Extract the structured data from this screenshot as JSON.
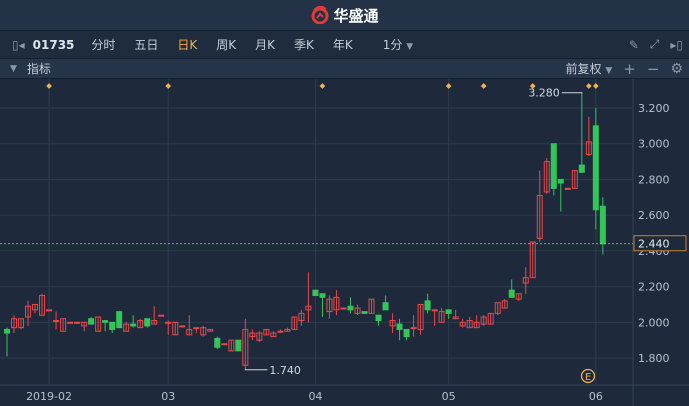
{
  "header": {
    "brand": "华盛通"
  },
  "toolbar": {
    "code": "01735",
    "tabs": [
      "分时",
      "五日",
      "日K",
      "周K",
      "月K",
      "季K",
      "年K"
    ],
    "active": "日K",
    "interval": "1分"
  },
  "indicator_bar": {
    "label": "指标",
    "adjust": "前复权"
  },
  "colors": {
    "up": "#e8484a",
    "down": "#32c55a",
    "accent": "#f0b24a",
    "grid": "#2d3b4f"
  },
  "chart_data": {
    "type": "candlestick",
    "y_ticks": [
      "3.200",
      "3.000",
      "2.800",
      "2.600",
      "2.400",
      "2.200",
      "2.000",
      "1.800"
    ],
    "ylim": [
      1.8,
      3.2
    ],
    "x_labels": [
      {
        "label": "2019-02",
        "index": 6
      },
      {
        "label": "03",
        "index": 23
      },
      {
        "label": "04",
        "index": 44
      },
      {
        "label": "05",
        "index": 63
      },
      {
        "label": "06",
        "index": 84
      }
    ],
    "current_price": "2.440",
    "max_label": "3.280",
    "min_label": "1.740",
    "candles": [
      [
        1.96,
        1.97,
        1.81,
        1.94
      ],
      [
        1.97,
        2.04,
        1.94,
        2.02
      ],
      [
        1.97,
        2.02,
        1.96,
        2.02
      ],
      [
        2.03,
        2.12,
        1.98,
        2.09
      ],
      [
        2.07,
        2.1,
        2.05,
        2.1
      ],
      [
        2.04,
        2.16,
        2.04,
        2.15
      ],
      [
        2.07,
        2.07,
        2.07,
        2.07
      ],
      [
        2.01,
        2.06,
        1.96,
        2.01
      ],
      [
        1.95,
        2.02,
        1.95,
        2.02
      ],
      [
        2,
        2,
        2,
        2
      ],
      [
        2,
        2,
        2,
        2
      ],
      [
        1.98,
        2,
        1.95,
        2
      ],
      [
        2.02,
        2.03,
        2,
        1.99
      ],
      [
        1.95,
        2.03,
        1.95,
        2.03
      ],
      [
        2.01,
        2.01,
        1.95,
        2
      ],
      [
        2,
        2,
        1.94,
        1.96
      ],
      [
        2.06,
        2.06,
        1.97,
        1.97
      ],
      [
        1.95,
        2,
        1.95,
        1.99
      ],
      [
        1.99,
        2.04,
        1.97,
        1.98
      ],
      [
        1.97,
        2.02,
        1.97,
        2.01
      ],
      [
        2.02,
        2.02,
        1.97,
        1.98
      ],
      [
        1.99,
        2.09,
        1.99,
        2.01
      ],
      [
        2.04,
        2.04,
        2.04,
        2.04
      ],
      [
        2,
        2.01,
        1.93,
        2
      ],
      [
        1.93,
        2,
        1.93,
        2
      ],
      [
        1.98,
        1.98,
        1.98,
        1.98
      ],
      [
        1.93,
        2.04,
        1.93,
        1.96
      ],
      [
        1.97,
        1.97,
        1.94,
        1.97
      ],
      [
        1.93,
        1.98,
        1.92,
        1.97
      ],
      [
        1.95,
        1.96,
        1.95,
        1.96
      ],
      [
        1.91,
        1.92,
        1.85,
        1.86
      ],
      [
        1.88,
        1.88,
        1.88,
        1.88
      ],
      [
        1.84,
        1.9,
        1.84,
        1.9
      ],
      [
        1.9,
        1.9,
        1.84,
        1.84
      ],
      [
        1.76,
        2.02,
        1.74,
        1.96
      ],
      [
        1.92,
        1.96,
        1.9,
        1.94
      ],
      [
        1.9,
        1.95,
        1.89,
        1.94
      ],
      [
        1.93,
        1.96,
        1.93,
        1.96
      ],
      [
        1.92,
        1.95,
        1.92,
        1.94
      ],
      [
        1.95,
        1.96,
        1.95,
        1.95
      ],
      [
        1.95,
        1.97,
        1.95,
        1.96
      ],
      [
        1.96,
        2.03,
        1.96,
        2.03
      ],
      [
        2.01,
        2.07,
        1.98,
        2.05
      ],
      [
        2.07,
        2.28,
        2,
        2.09
      ],
      [
        2.18,
        2.18,
        2.15,
        2.15
      ],
      [
        2.16,
        2.16,
        2.03,
        2.14
      ],
      [
        2.06,
        2.15,
        2.02,
        2.13
      ],
      [
        2.07,
        2.18,
        2.04,
        2.14
      ],
      [
        2.08,
        2.08,
        2.08,
        2.08
      ],
      [
        2.09,
        2.14,
        2.05,
        2.07
      ],
      [
        2.05,
        2.1,
        2.04,
        2.08
      ],
      [
        2.06,
        2.06,
        2.05,
        2.05
      ],
      [
        2.05,
        2.13,
        2.05,
        2.13
      ],
      [
        2.04,
        2.04,
        1.98,
        2.01
      ],
      [
        2.11,
        2.15,
        2.07,
        2.07
      ],
      [
        1.98,
        2.05,
        1.94,
        2.01
      ],
      [
        1.99,
        2.02,
        1.9,
        1.96
      ],
      [
        1.96,
        1.96,
        1.9,
        1.92
      ],
      [
        1.97,
        2.04,
        1.92,
        1.97
      ],
      [
        1.96,
        2.1,
        1.93,
        2.1
      ],
      [
        2.12,
        2.16,
        2.05,
        2.07
      ],
      [
        2.07,
        2.07,
        1.98,
        2.07
      ],
      [
        2,
        2.08,
        2,
        2.06
      ],
      [
        2.07,
        2.07,
        2.02,
        2.05
      ],
      [
        2.02,
        2.07,
        2.02,
        2.03
      ],
      [
        1.98,
        2.02,
        1.97,
        2
      ],
      [
        1.97,
        2.03,
        1.97,
        2.01
      ],
      [
        1.97,
        2.04,
        1.97,
        2
      ],
      [
        1.99,
        2.04,
        1.98,
        2.03
      ],
      [
        1.99,
        2.05,
        1.99,
        2.05
      ],
      [
        2.05,
        2.11,
        2.04,
        2.11
      ],
      [
        2.08,
        2.13,
        2.08,
        2.12
      ],
      [
        2.18,
        2.24,
        2.14,
        2.14
      ],
      [
        2.13,
        2.16,
        2.12,
        2.16
      ],
      [
        2.22,
        2.31,
        2.16,
        2.25
      ],
      [
        2.25,
        2.45,
        2.25,
        2.45
      ],
      [
        2.47,
        2.85,
        2.45,
        2.71
      ],
      [
        2.73,
        2.92,
        2.72,
        2.9
      ],
      [
        3,
        3,
        2.71,
        2.75
      ],
      [
        2.8,
        2.8,
        2.62,
        2.78
      ],
      [
        2.75,
        2.75,
        2.75,
        2.75
      ],
      [
        2.75,
        2.85,
        2.75,
        2.85
      ],
      [
        2.88,
        3.28,
        2.85,
        2.84
      ],
      [
        2.94,
        3.15,
        2.93,
        3.01
      ],
      [
        3.1,
        3.2,
        2.52,
        2.63
      ],
      [
        2.65,
        2.7,
        2.38,
        2.44
      ]
    ],
    "event_markers": [
      6,
      23,
      45,
      63,
      68,
      75,
      83,
      84
    ],
    "event_badge": "E"
  }
}
